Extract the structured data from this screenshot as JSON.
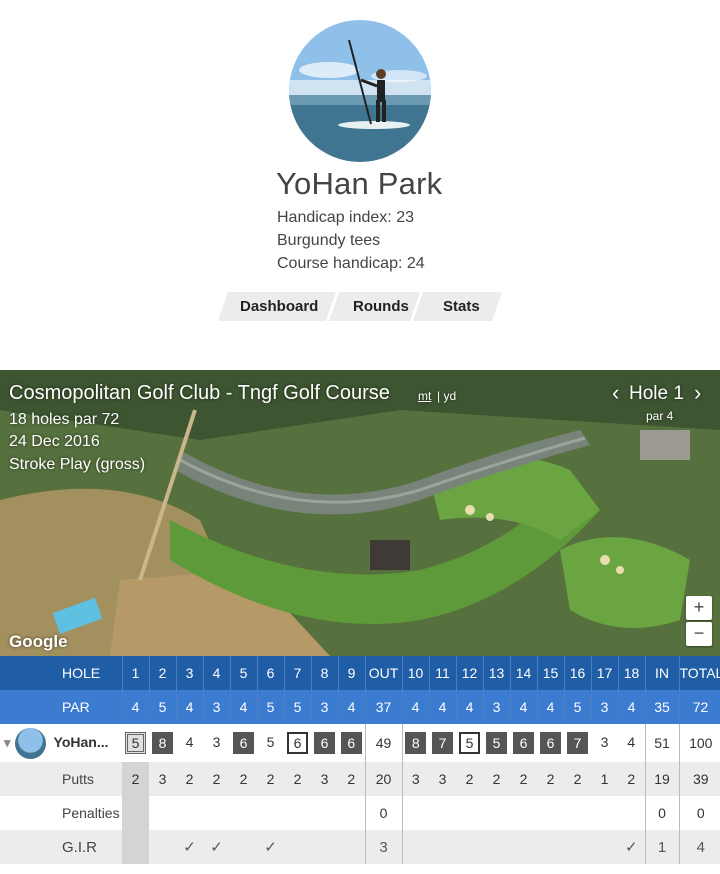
{
  "profile": {
    "name": "YoHan Park",
    "handicap_index": "Handicap index: 23",
    "tees": "Burgundy tees",
    "course_handicap": "Course handicap: 24"
  },
  "nav": {
    "tabs": [
      "Dashboard",
      "Rounds",
      "Stats"
    ]
  },
  "course": {
    "title": "Cosmopolitan Golf Club - Tngf Golf Course",
    "unit_mt": "mt",
    "unit_yd": "| yd",
    "holes_par": "18 holes par 72",
    "date": "24 Dec 2016",
    "mode": "Stroke Play (gross)",
    "hole_label": "Hole 1",
    "hole_par": "par 4",
    "zoom_in": "+",
    "zoom_out": "−",
    "map_logo": "Google"
  },
  "scorecard": {
    "hole_header": "HOLE",
    "holes": [
      "1",
      "2",
      "3",
      "4",
      "5",
      "6",
      "7",
      "8",
      "9",
      "OUT",
      "10",
      "11",
      "12",
      "13",
      "14",
      "15",
      "16",
      "17",
      "18",
      "IN",
      "TOTAL"
    ],
    "par_label": "PAR",
    "par": [
      "4",
      "5",
      "4",
      "3",
      "4",
      "5",
      "5",
      "3",
      "4",
      "37",
      "4",
      "4",
      "4",
      "3",
      "4",
      "4",
      "5",
      "3",
      "4",
      "35",
      "72"
    ],
    "player_name": "YoHan...",
    "scores": [
      "5",
      "8",
      "4",
      "3",
      "6",
      "5",
      "6",
      "6",
      "6",
      "49",
      "8",
      "7",
      "5",
      "5",
      "6",
      "6",
      "7",
      "3",
      "4",
      "51",
      "100"
    ],
    "putts_label": "Putts",
    "putts": [
      "2",
      "3",
      "2",
      "2",
      "2",
      "2",
      "2",
      "3",
      "2",
      "20",
      "3",
      "3",
      "2",
      "2",
      "2",
      "2",
      "2",
      "1",
      "2",
      "19",
      "39"
    ],
    "penalties_label": "Penalties",
    "penalties": [
      "",
      "",
      "",
      "",
      "",
      "",
      "",
      "",
      "",
      "0",
      "",
      "",
      "",
      "",
      "",
      "",
      "",
      "",
      "",
      "0",
      "0"
    ],
    "gir_label": "G.I.R",
    "gir": [
      "",
      "",
      "✓",
      "✓",
      "",
      "✓",
      "",
      "",
      "",
      "3",
      "",
      "",
      "",
      "",
      "",
      "",
      "",
      "",
      "✓",
      "1",
      "4"
    ]
  },
  "colors": {
    "hole_row": "#1f5da6",
    "par_row": "#3b7bd0"
  }
}
